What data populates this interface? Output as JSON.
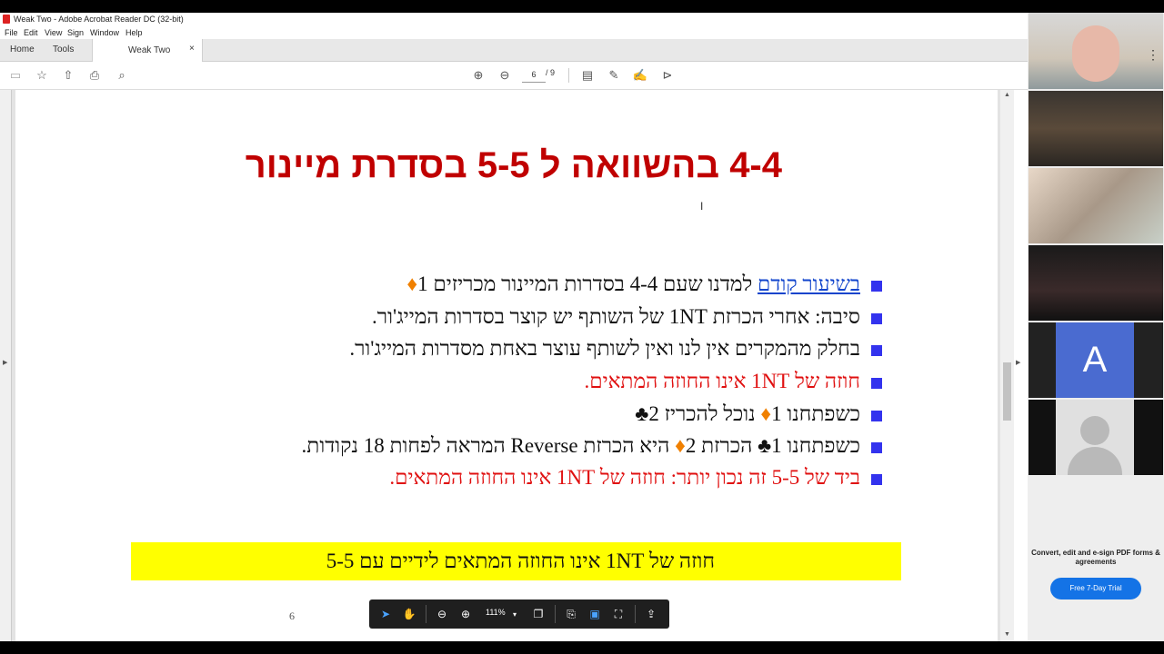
{
  "window": {
    "title": "Weak Two - Adobe Acrobat Reader DC (32-bit)"
  },
  "menu": [
    "File",
    "Edit",
    "View",
    "Sign",
    "Window",
    "Help"
  ],
  "tabs": {
    "home": "Home",
    "tools": "Tools",
    "doc": "Weak Two",
    "close": "×"
  },
  "nav": {
    "page_current": "6",
    "page_total": "/ 9"
  },
  "slide": {
    "title": "4-4 בהשוואה ל 5-5 בסדרת מיינור",
    "b1_link": "בשיעור קודם",
    "b1_rest": " למדנו שעם 4-4 בסדרות המיינור מכריזים 1",
    "b2": "סיבה: אחרי הכרזת 1NT של השותף יש קוצר בסדרות המייג'ור.",
    "b3": "בחלק מהמקרים אין לנו ואין לשותף עוצר באחת מסדרות המייג'ור.",
    "b4": "חוזה של 1NT אינו החוזה המתאים.",
    "b5_a": "כשפתחנו ",
    "b5_b": "1",
    "b5_c": " נוכל להכריז ",
    "b5_d": "2",
    "b6_a": "כשפתחנו ",
    "b6_b": "1",
    "b6_c": " הכרזת ",
    "b6_d": "2",
    "b6_e": " היא הכרזת Reverse המראה לפחות 18 נקודות.",
    "b7": "ביד של 5-5 זה נכון יותר: חוזה של 1NT אינו החוזה המתאים.",
    "highlight": "חוזה של 1NT אינו החוזה המתאים לידיים עם 5-5",
    "page_number": "6",
    "diamond": "♦",
    "club": "♣"
  },
  "float_toolbar": {
    "zoom": "111%"
  },
  "call": {
    "tile_a_initial": "A"
  },
  "promo": {
    "text": "Convert, edit and e-sign PDF forms & agreements",
    "button": "Free 7-Day Trial"
  },
  "colors": {
    "title_red": "#c00000",
    "bullet_blue": "#3333ee",
    "highlight_yellow": "#ffff00",
    "diamond_orange": "#f08000"
  }
}
